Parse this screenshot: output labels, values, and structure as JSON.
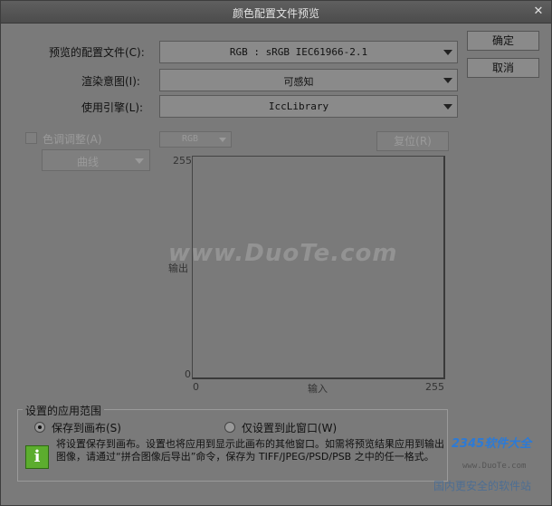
{
  "window": {
    "title": "颜色配置文件预览"
  },
  "fields": {
    "profile": {
      "label": "预览的配置文件(C):",
      "value": "RGB : sRGB IEC61966-2.1"
    },
    "intent": {
      "label": "渲染意图(I):",
      "value": "可感知"
    },
    "engine": {
      "label": "使用引擎(L):",
      "value": "IccLibrary"
    }
  },
  "buttons": {
    "ok": "确定",
    "cancel": "取消",
    "reset": "复位(R)"
  },
  "tone": {
    "checkbox_label": "色调调整(A)",
    "channel": "RGB",
    "curve": "曲线"
  },
  "graph": {
    "y_top": "255",
    "y_bottom": "0",
    "y_label": "输出",
    "x_left": "0",
    "x_right": "255",
    "x_label": "输入"
  },
  "scope": {
    "title": "设置的应用范围",
    "option1": "保存到画布(S)",
    "option2": "仅设置到此窗口(W)",
    "description": "将设置保存到画布。设置也将应用到显示此画布的其他窗口。如需将预览结果应用到输出图像，请通过“拼合图像后导出”命令，保存为 TIFF/JPEG/PSD/PSB 之中的任一格式。",
    "selected": "option1"
  },
  "watermark": {
    "site": "www.DuoTe.com",
    "brand": "2345软件大全",
    "brand_url": "www.DuoTe.com",
    "brand_slogan": "国内更安全的软件站"
  },
  "icons": {
    "close": "close-icon",
    "info": "info-icon",
    "dropdown": "chevron-down-icon"
  }
}
